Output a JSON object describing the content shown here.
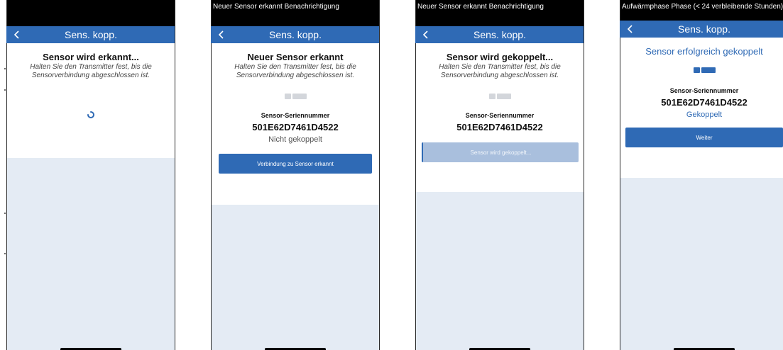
{
  "screen1": {
    "nav_title": "Sens. kopp.",
    "heading": "Sensor wird erkannt...",
    "instruction": "Halten Sie den Transmitter fest, bis die Sensorverbindung abgeschlossen ist."
  },
  "screen2": {
    "status": "Neuer Sensor erkannt Benachrichtigung",
    "nav_title": "Sens. kopp.",
    "heading": "Neuer Sensor erkannt",
    "instruction": "Halten Sie den Transmitter fest, bis die Sensorverbindung abgeschlossen ist.",
    "serial_label": "Sensor-Seriennummer",
    "serial": "501E62D7461D4522",
    "state": "Nicht gekoppelt",
    "button": "Verbindung zu Sensor erkannt"
  },
  "screen3": {
    "status": "Neuer Sensor erkannt Benachrichtigung",
    "nav_title": "Sens. kopp.",
    "heading": "Sensor wird gekoppelt...",
    "instruction": "Halten Sie den Transmitter fest, bis die Sensorverbindung abgeschlossen ist.",
    "serial_label": "Sensor-Seriennummer",
    "serial": "501E62D7461D4522",
    "button": "Sensor wird gekoppelt..."
  },
  "screen4": {
    "status": "Aufwärmphase Phase (< 24 verbleibende Stunden)",
    "nav_title": "Sens. kopp.",
    "heading": "Sensor erfolgreich gekoppelt",
    "serial_label": "Sensor-Seriennummer",
    "serial": "501E62D7461D4522",
    "state": "Gekoppelt",
    "button": "Weiter"
  },
  "colors": {
    "brand_blue": "#2f6ab5",
    "disabled_button": "#a9bfdd",
    "background": "#e4ebf4"
  },
  "icons": [
    "back-chevron-icon",
    "loading-spinner-icon",
    "sensor-transmitter-icon"
  ]
}
